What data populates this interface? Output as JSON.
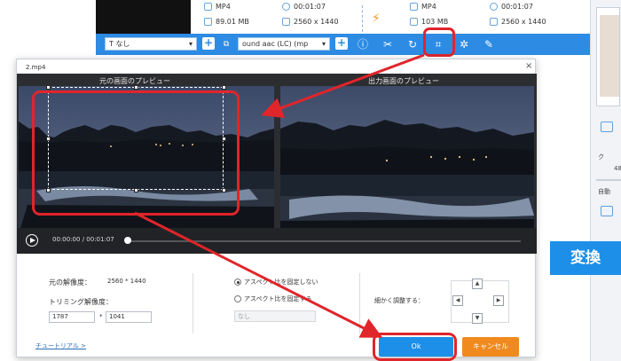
{
  "source": {
    "format": "MP4",
    "duration": "00:01:07",
    "size": "89.01 MB",
    "resolution": "2560 x 1440"
  },
  "output": {
    "format": "MP4",
    "duration": "00:01:07",
    "size": "103 MB",
    "resolution": "2560 x 1440"
  },
  "toolbar": {
    "subtitle_select": "なし",
    "audio_select": "ound aac (LC) (mp"
  },
  "right_panel": {
    "label_1": "ク",
    "label_2": "自動",
    "label_3": "48"
  },
  "convert_button": "変換",
  "dialog": {
    "title": "2.mp4",
    "close": "×",
    "original_preview_label": "元の画面のプレビュー",
    "output_preview_label": "出力画面のプレビュー",
    "time_current": "00:00:00",
    "time_separator": "/",
    "time_total": "00:01:07",
    "original_resolution_label": "元の解像度：",
    "original_resolution_value": "2560 * 1440",
    "trim_resolution_label": "トリミング解像度：",
    "trim_width": "1787",
    "trim_multiply": "*",
    "trim_height": "1041",
    "aspect_unfixed_label": "アスペクト比を固定しない",
    "aspect_fixed_label": "アスペクト比を固定する",
    "aspect_select": "なし",
    "fine_tune_label": "細かく調整する：",
    "tutorial_link": "チュートリアル >",
    "ok_label": "Ok",
    "cancel_label": "キャンセル"
  }
}
